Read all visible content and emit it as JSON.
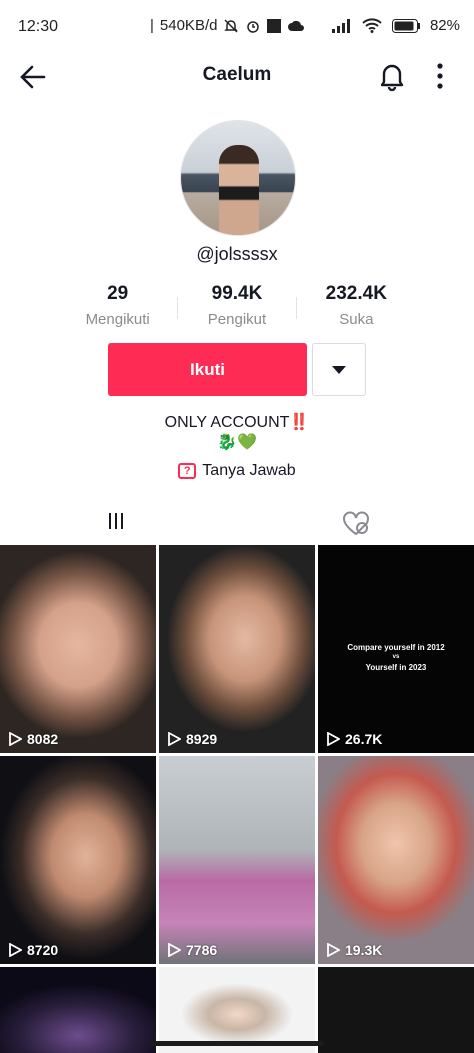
{
  "status_bar": {
    "time": "12:30",
    "network_speed": "540KB/d",
    "battery": "82%"
  },
  "header": {
    "title": "Caelum"
  },
  "profile": {
    "username": "@jolssssx",
    "stats": [
      {
        "value": "29",
        "label": "Mengikuti"
      },
      {
        "value": "99.4K",
        "label": "Pengikut"
      },
      {
        "value": "232.4K",
        "label": "Suka"
      }
    ],
    "follow_label": "Ikuti",
    "bio_line1": "ONLY ACCOUNT",
    "bio_mark": "‼️",
    "bio_line2": "🐉💚",
    "qa_label": "Tanya Jawab"
  },
  "videos": [
    {
      "views": "8082"
    },
    {
      "views": "8929"
    },
    {
      "views": "26.7K",
      "overlay_line1": "Compare yourself in 2012",
      "overlay_line2": "vs",
      "overlay_line3": "Yourself in 2023"
    },
    {
      "views": "8720"
    },
    {
      "views": "7786"
    },
    {
      "views": "19.3K"
    },
    {
      "views": ""
    },
    {
      "views": ""
    },
    {
      "views": ""
    }
  ],
  "colors": {
    "accent": "#fe2c55",
    "text": "#161823",
    "muted": "#8a8b91"
  }
}
